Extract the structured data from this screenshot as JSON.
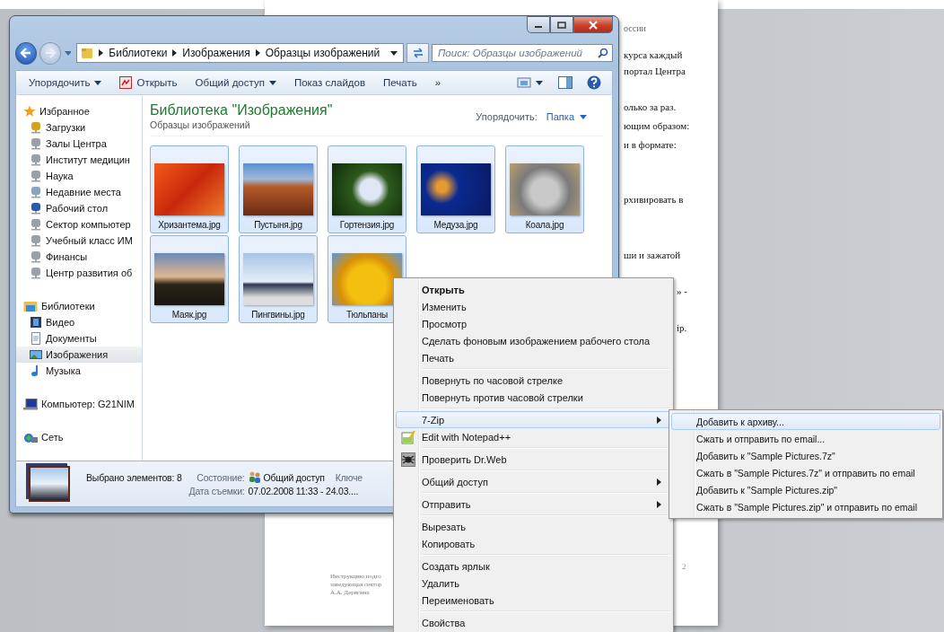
{
  "document": {
    "lines": [
      "оссии",
      "курса  каждый",
      "портал Центра",
      "олько за раз.",
      "ющим образом:",
      "и  в  формате:",
      "рхивировать в",
      "ши и зажатой",
      "» -",
      "ip."
    ],
    "page_number": "2",
    "footer": [
      "Инструкцию подго",
      "заведующая сектор",
      "А.А. Дерягина"
    ]
  },
  "explorer": {
    "address": {
      "breadcrumbs": [
        "Библиотеки",
        "Изображения",
        "Образцы изображений"
      ],
      "search_placeholder": "Поиск: Образцы изображений"
    },
    "toolbar": [
      {
        "label": "Упорядочить",
        "dropdown": true,
        "kind": "text"
      },
      {
        "label": "Открыть",
        "dropdown": false,
        "kind": "icon-text"
      },
      {
        "label": "Общий доступ",
        "dropdown": true,
        "kind": "text"
      },
      {
        "label": "Показ слайдов",
        "dropdown": false,
        "kind": "text"
      },
      {
        "label": "Печать",
        "dropdown": false,
        "kind": "text"
      },
      {
        "label": "»",
        "dropdown": false,
        "kind": "text"
      }
    ],
    "sidebar": [
      {
        "label": "Избранное",
        "selected": false,
        "children": [
          {
            "label": "Загрузки",
            "selected": false
          },
          {
            "label": "Залы Центра",
            "selected": false
          },
          {
            "label": "Институт медицин",
            "selected": false
          },
          {
            "label": "Наука",
            "selected": false
          },
          {
            "label": "Недавние места",
            "selected": false
          },
          {
            "label": "Рабочий стол",
            "selected": false
          },
          {
            "label": "Сектор компьютер",
            "selected": false
          },
          {
            "label": "Учебный класс ИМ",
            "selected": false
          },
          {
            "label": "Финансы",
            "selected": false
          },
          {
            "label": "Центр развития об",
            "selected": false
          }
        ]
      },
      {
        "label": "Библиотеки",
        "selected": false,
        "children": [
          {
            "label": "Видео",
            "selected": false
          },
          {
            "label": "Документы",
            "selected": false
          },
          {
            "label": "Изображения",
            "selected": true
          },
          {
            "label": "Музыка",
            "selected": false
          }
        ]
      },
      {
        "label": "Компьютер: G21NIM",
        "selected": false
      },
      {
        "label": "Сеть",
        "selected": false
      }
    ],
    "header": {
      "title": "Библиотека \"Изображения\"",
      "subtitle": "Образцы изображений",
      "arrange_label": "Упорядочить:",
      "arrange_value": "Папка"
    },
    "files": [
      {
        "name": "Хризантема.jpg",
        "selected": true
      },
      {
        "name": "Пустыня.jpg",
        "selected": true
      },
      {
        "name": "Гортензия.jpg",
        "selected": true
      },
      {
        "name": "Медуза.jpg",
        "selected": true
      },
      {
        "name": "Коала.jpg",
        "selected": true
      },
      {
        "name": "Маяк.jpg",
        "selected": true
      },
      {
        "name": "Пингвины.jpg",
        "selected": true
      },
      {
        "name": "Тюльпаны",
        "selected": true
      }
    ],
    "status": {
      "count": "Выбрано элементов: 8",
      "state_label": "Состояние:",
      "state_value": "Общий доступ",
      "keywords_label": "Ключе",
      "date_label": "Дата съемки:",
      "date_value": "07.02.2008 11:33 - 24.03...."
    }
  },
  "context_menu": [
    {
      "kind": "item",
      "label": "Открыть",
      "default": true,
      "selected": false,
      "submenu": false
    },
    {
      "kind": "item",
      "label": "Изменить",
      "default": false,
      "selected": false,
      "submenu": false
    },
    {
      "kind": "item",
      "label": "Просмотр",
      "default": false,
      "selected": false,
      "submenu": false
    },
    {
      "kind": "item",
      "label": "Сделать фоновым изображением рабочего стола",
      "default": false,
      "selected": false,
      "submenu": false
    },
    {
      "kind": "item",
      "label": "Печать",
      "default": false,
      "selected": false,
      "submenu": false
    },
    {
      "kind": "separator"
    },
    {
      "kind": "item",
      "label": "Повернуть по часовой стрелке",
      "default": false,
      "selected": false,
      "submenu": false
    },
    {
      "kind": "item",
      "label": "Повернуть против часовой стрелки",
      "default": false,
      "selected": false,
      "submenu": false
    },
    {
      "kind": "separator"
    },
    {
      "kind": "item",
      "label": "7-Zip",
      "default": false,
      "selected": true,
      "submenu": true
    },
    {
      "kind": "icon-item",
      "label": "Edit with Notepad++",
      "default": false,
      "selected": false,
      "submenu": false
    },
    {
      "kind": "separator"
    },
    {
      "kind": "icon-item",
      "label": "Проверить Dr.Web",
      "default": false,
      "selected": false,
      "submenu": false
    },
    {
      "kind": "separator"
    },
    {
      "kind": "item",
      "label": "Общий доступ",
      "default": false,
      "selected": false,
      "submenu": true
    },
    {
      "kind": "separator"
    },
    {
      "kind": "item",
      "label": "Отправить",
      "default": false,
      "selected": false,
      "submenu": true
    },
    {
      "kind": "separator"
    },
    {
      "kind": "item",
      "label": "Вырезать",
      "default": false,
      "selected": false,
      "submenu": false
    },
    {
      "kind": "item",
      "label": "Копировать",
      "default": false,
      "selected": false,
      "submenu": false
    },
    {
      "kind": "separator"
    },
    {
      "kind": "item",
      "label": "Создать ярлык",
      "default": false,
      "selected": false,
      "submenu": false
    },
    {
      "kind": "item",
      "label": "Удалить",
      "default": false,
      "selected": false,
      "submenu": false
    },
    {
      "kind": "item",
      "label": "Переименовать",
      "default": false,
      "selected": false,
      "submenu": false
    },
    {
      "kind": "separator"
    },
    {
      "kind": "item",
      "label": "Свойства",
      "default": false,
      "selected": false,
      "submenu": false
    }
  ],
  "submenu": [
    {
      "label": "Добавить к архиву...",
      "selected": true
    },
    {
      "label": "Сжать и отправить по email...",
      "selected": false
    },
    {
      "label": "Добавить к \"Sample Pictures.7z\"",
      "selected": false
    },
    {
      "label": "Сжать в \"Sample Pictures.7z\" и отправить по email",
      "selected": false
    },
    {
      "label": "Добавить к \"Sample Pictures.zip\"",
      "selected": false
    },
    {
      "label": "Сжать в \"Sample Pictures.zip\" и отправить по email",
      "selected": false
    }
  ]
}
